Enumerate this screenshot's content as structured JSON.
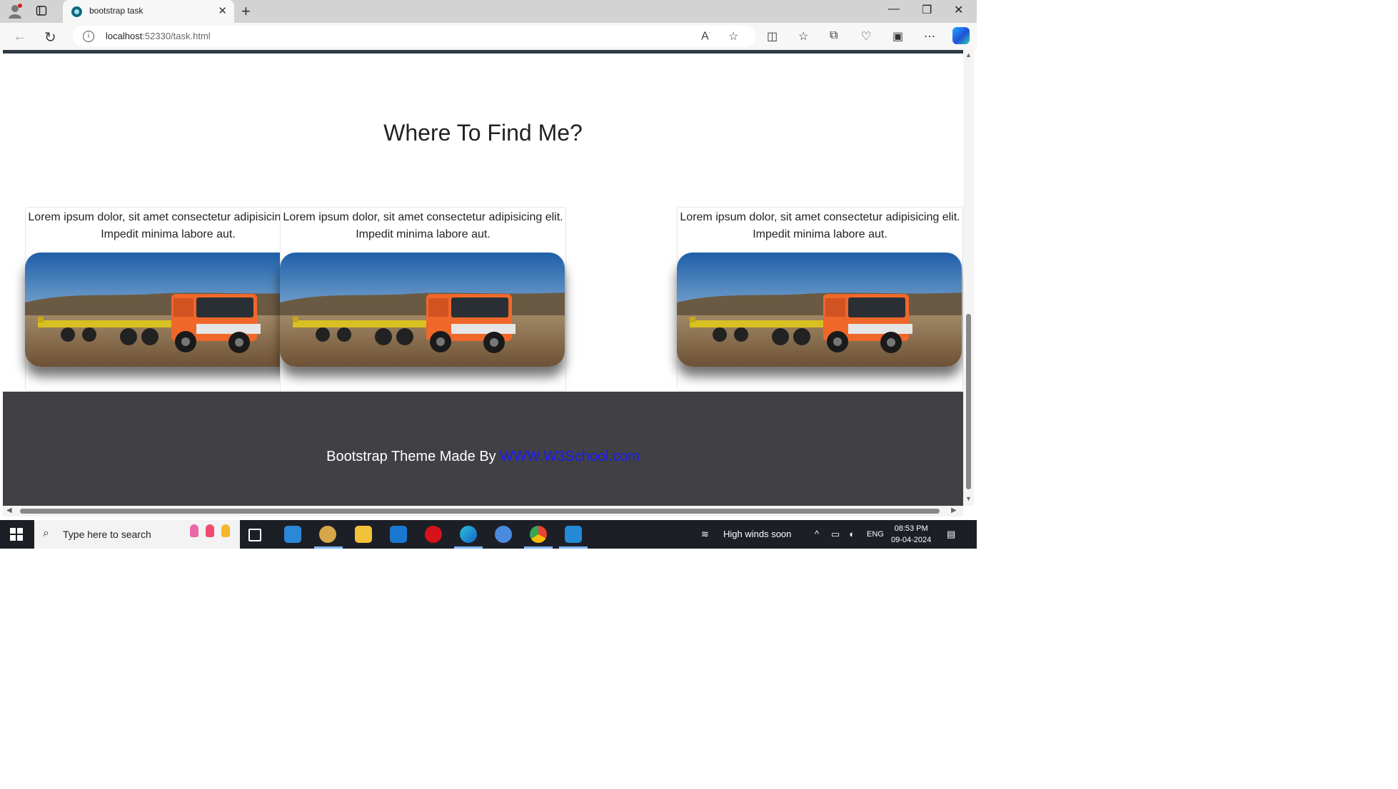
{
  "browser": {
    "tab_title": "bootstrap task",
    "tab_close": "✕",
    "new_tab": "+",
    "url_host": "localhost",
    "url_rest": ":52330/task.html"
  },
  "page": {
    "heading": "Where To Find Me?",
    "cards": [
      {
        "text": "Lorem ipsum dolor, sit amet consectetur adipisicing elit. Impedit minima labore aut."
      },
      {
        "text": "Lorem ipsum dolor, sit amet consectetur adipisicing elit. Impedit minima labore aut."
      },
      {
        "text": "Lorem ipsum dolor, sit amet consectetur adipisicing elit. Impedit minima labore aut."
      }
    ],
    "footer_text": "Bootstrap Theme Made By ",
    "footer_link": "WWW.W3School.com"
  },
  "taskbar": {
    "search_placeholder": "Type here to search",
    "weather": "High winds soon",
    "language": "ENG",
    "time": "08:53 PM",
    "date": "09-04-2024"
  },
  "colors": {
    "footer_bg": "#414045",
    "link": "#1a1aff",
    "topbar": "#2f3b47"
  }
}
